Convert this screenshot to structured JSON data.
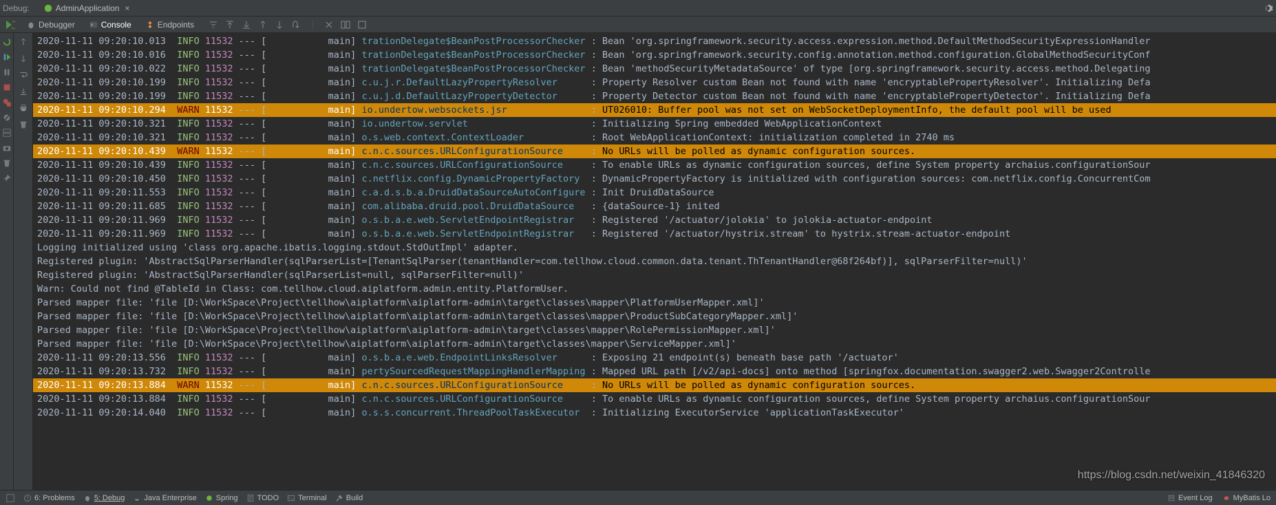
{
  "header": {
    "debug_label": "Debug:",
    "app_name": "AdminApplication",
    "close_label": "×"
  },
  "tool_tabs": {
    "debugger": "Debugger",
    "console": "Console",
    "endpoints": "Endpoints"
  },
  "log_lines": [
    {
      "type": "log",
      "level": "INFO",
      "ts": "2020-11-11 09:20:10.013",
      "pid": "11532",
      "thread": "main",
      "logger": "trationDelegate$BeanPostProcessorChecker",
      "msg": "Bean 'org.springframework.security.access.expression.method.DefaultMethodSecurityExpressionHandler"
    },
    {
      "type": "log",
      "level": "INFO",
      "ts": "2020-11-11 09:20:10.016",
      "pid": "11532",
      "thread": "main",
      "logger": "trationDelegate$BeanPostProcessorChecker",
      "msg": "Bean 'org.springframework.security.config.annotation.method.configuration.GlobalMethodSecurityConf"
    },
    {
      "type": "log",
      "level": "INFO",
      "ts": "2020-11-11 09:20:10.022",
      "pid": "11532",
      "thread": "main",
      "logger": "trationDelegate$BeanPostProcessorChecker",
      "msg": "Bean 'methodSecurityMetadataSource' of type [org.springframework.security.access.method.Delegating"
    },
    {
      "type": "log",
      "level": "INFO",
      "ts": "2020-11-11 09:20:10.199",
      "pid": "11532",
      "thread": "main",
      "logger": "c.u.j.r.DefaultLazyPropertyResolver     ",
      "msg": "Property Resolver custom Bean not found with name 'encryptablePropertyResolver'. Initializing Defa"
    },
    {
      "type": "log",
      "level": "INFO",
      "ts": "2020-11-11 09:20:10.199",
      "pid": "11532",
      "thread": "main",
      "logger": "c.u.j.d.DefaultLazyPropertyDetector     ",
      "msg": "Property Detector custom Bean not found with name 'encryptablePropertyDetector'. Initializing Defa"
    },
    {
      "type": "log",
      "level": "WARN",
      "ts": "2020-11-11 09:20:10.294",
      "pid": "11532",
      "thread": "main",
      "logger": "io.undertow.websockets.jsr              ",
      "msg": "UT026010: Buffer pool was not set on WebSocketDeploymentInfo, the default pool will be used"
    },
    {
      "type": "log",
      "level": "INFO",
      "ts": "2020-11-11 09:20:10.321",
      "pid": "11532",
      "thread": "main",
      "logger": "io.undertow.servlet                     ",
      "msg": "Initializing Spring embedded WebApplicationContext"
    },
    {
      "type": "log",
      "level": "INFO",
      "ts": "2020-11-11 09:20:10.321",
      "pid": "11532",
      "thread": "main",
      "logger": "o.s.web.context.ContextLoader           ",
      "msg": "Root WebApplicationContext: initialization completed in 2740 ms"
    },
    {
      "type": "log",
      "level": "WARN",
      "ts": "2020-11-11 09:20:10.439",
      "pid": "11532",
      "thread": "main",
      "logger": "c.n.c.sources.URLConfigurationSource    ",
      "msg": "No URLs will be polled as dynamic configuration sources."
    },
    {
      "type": "log",
      "level": "INFO",
      "ts": "2020-11-11 09:20:10.439",
      "pid": "11532",
      "thread": "main",
      "logger": "c.n.c.sources.URLConfigurationSource    ",
      "msg": "To enable URLs as dynamic configuration sources, define System property archaius.configurationSour"
    },
    {
      "type": "log",
      "level": "INFO",
      "ts": "2020-11-11 09:20:10.450",
      "pid": "11532",
      "thread": "main",
      "logger": "c.netflix.config.DynamicPropertyFactory ",
      "msg": "DynamicPropertyFactory is initialized with configuration sources: com.netflix.config.ConcurrentCom"
    },
    {
      "type": "log",
      "level": "INFO",
      "ts": "2020-11-11 09:20:11.553",
      "pid": "11532",
      "thread": "main",
      "logger": "c.a.d.s.b.a.DruidDataSourceAutoConfigure",
      "msg": "Init DruidDataSource"
    },
    {
      "type": "log",
      "level": "INFO",
      "ts": "2020-11-11 09:20:11.685",
      "pid": "11532",
      "thread": "main",
      "logger": "com.alibaba.druid.pool.DruidDataSource  ",
      "msg": "{dataSource-1} inited"
    },
    {
      "type": "log",
      "level": "INFO",
      "ts": "2020-11-11 09:20:11.969",
      "pid": "11532",
      "thread": "main",
      "logger": "o.s.b.a.e.web.ServletEndpointRegistrar  ",
      "msg": "Registered '/actuator/jolokia' to jolokia-actuator-endpoint"
    },
    {
      "type": "log",
      "level": "INFO",
      "ts": "2020-11-11 09:20:11.969",
      "pid": "11532",
      "thread": "main",
      "logger": "o.s.b.a.e.web.ServletEndpointRegistrar  ",
      "msg": "Registered '/actuator/hystrix.stream' to hystrix.stream-actuator-endpoint"
    },
    {
      "type": "plain",
      "text": "Logging initialized using 'class org.apache.ibatis.logging.stdout.StdOutImpl' adapter."
    },
    {
      "type": "plain",
      "text": "Registered plugin: 'AbstractSqlParserHandler(sqlParserList=[TenantSqlParser(tenantHandler=com.tellhow.cloud.common.data.tenant.ThTenantHandler@68f264bf)], sqlParserFilter=null)'"
    },
    {
      "type": "plain",
      "text": "Registered plugin: 'AbstractSqlParserHandler(sqlParserList=null, sqlParserFilter=null)'"
    },
    {
      "type": "plain",
      "text": "Warn: Could not find @TableId in Class: com.tellhow.cloud.aiplatform.admin.entity.PlatformUser."
    },
    {
      "type": "plain",
      "text": "Parsed mapper file: 'file [D:\\WorkSpace\\Project\\tellhow\\aiplatform\\aiplatform-admin\\target\\classes\\mapper\\PlatformUserMapper.xml]'"
    },
    {
      "type": "plain",
      "text": "Parsed mapper file: 'file [D:\\WorkSpace\\Project\\tellhow\\aiplatform\\aiplatform-admin\\target\\classes\\mapper\\ProductSubCategoryMapper.xml]'"
    },
    {
      "type": "plain",
      "text": "Parsed mapper file: 'file [D:\\WorkSpace\\Project\\tellhow\\aiplatform\\aiplatform-admin\\target\\classes\\mapper\\RolePermissionMapper.xml]'"
    },
    {
      "type": "plain",
      "text": "Parsed mapper file: 'file [D:\\WorkSpace\\Project\\tellhow\\aiplatform\\aiplatform-admin\\target\\classes\\mapper\\ServiceMapper.xml]'"
    },
    {
      "type": "log",
      "level": "INFO",
      "ts": "2020-11-11 09:20:13.556",
      "pid": "11532",
      "thread": "main",
      "logger": "o.s.b.a.e.web.EndpointLinksResolver     ",
      "msg": "Exposing 21 endpoint(s) beneath base path '/actuator'"
    },
    {
      "type": "log",
      "level": "INFO",
      "ts": "2020-11-11 09:20:13.732",
      "pid": "11532",
      "thread": "main",
      "logger": "pertySourcedRequestMappingHandlerMapping",
      "msg": "Mapped URL path [/v2/api-docs] onto method [springfox.documentation.swagger2.web.Swagger2Controlle"
    },
    {
      "type": "log",
      "level": "WARN",
      "ts": "2020-11-11 09:20:13.884",
      "pid": "11532",
      "thread": "main",
      "logger": "c.n.c.sources.URLConfigurationSource    ",
      "msg": "No URLs will be polled as dynamic configuration sources."
    },
    {
      "type": "log",
      "level": "INFO",
      "ts": "2020-11-11 09:20:13.884",
      "pid": "11532",
      "thread": "main",
      "logger": "c.n.c.sources.URLConfigurationSource    ",
      "msg": "To enable URLs as dynamic configuration sources, define System property archaius.configurationSour"
    },
    {
      "type": "log",
      "level": "INFO",
      "ts": "2020-11-11 09:20:14.040",
      "pid": "11532",
      "thread": "main",
      "logger": "o.s.s.concurrent.ThreadPoolTaskExecutor ",
      "msg": "Initializing ExecutorService 'applicationTaskExecutor'"
    }
  ],
  "status": {
    "problems": "6: Problems",
    "debug": "5: Debug",
    "java_ent": "Java Enterprise",
    "spring": "Spring",
    "todo": "TODO",
    "terminal": "Terminal",
    "build": "Build",
    "event_log": "Event Log",
    "mybatis": "MyBatis Lo"
  },
  "watermark": "https://blog.csdn.net/weixin_41846320"
}
